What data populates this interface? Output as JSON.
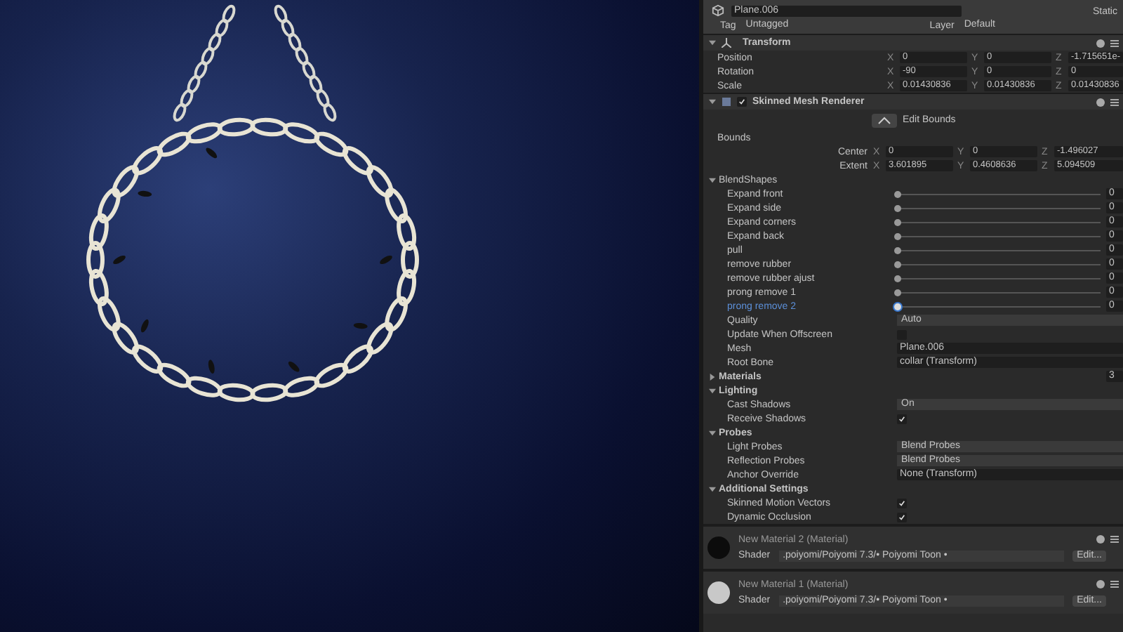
{
  "object": {
    "name": "Plane.006",
    "static_label": "Static",
    "tag_label": "Tag",
    "tag": "Untagged",
    "layer_label": "Layer",
    "layer": "Default"
  },
  "transform": {
    "title": "Transform",
    "expanded": true,
    "fields": [
      {
        "label": "Position",
        "values": [
          {
            "axis": "X",
            "value": "0"
          },
          {
            "axis": "Y",
            "value": "0"
          },
          {
            "axis": "Z",
            "value": "-1.715651e-"
          }
        ]
      },
      {
        "label": "Rotation",
        "values": [
          {
            "axis": "X",
            "value": "-90"
          },
          {
            "axis": "Y",
            "value": "0"
          },
          {
            "axis": "Z",
            "value": "0"
          }
        ]
      },
      {
        "label": "Scale",
        "values": [
          {
            "axis": "X",
            "value": "0.01430836"
          },
          {
            "axis": "Y",
            "value": "0.01430836"
          },
          {
            "axis": "Z",
            "value": "0.01430836"
          }
        ]
      }
    ]
  },
  "renderer": {
    "title": "Skinned Mesh Renderer",
    "expanded": true,
    "enabled": true,
    "edit_bounds": "Edit Bounds",
    "bounds_label": "Bounds",
    "bounds": [
      {
        "label": "Center",
        "values": [
          {
            "axis": "X",
            "value": "0"
          },
          {
            "axis": "Y",
            "value": "0"
          },
          {
            "axis": "Z",
            "value": "-1.496027"
          }
        ]
      },
      {
        "label": "Extent",
        "values": [
          {
            "axis": "X",
            "value": "3.601895"
          },
          {
            "axis": "Y",
            "value": "0.4608636"
          },
          {
            "axis": "Z",
            "value": "5.094509"
          }
        ]
      }
    ],
    "blend_shapes": {
      "title": "BlendShapes",
      "expanded": true,
      "items": [
        {
          "name": "Expand front",
          "level": 0,
          "value": "0",
          "selected": false
        },
        {
          "name": "Expand side",
          "level": 0,
          "value": "0",
          "selected": false
        },
        {
          "name": "Expand corners",
          "level": 0,
          "value": "0",
          "selected": false
        },
        {
          "name": "Expand back",
          "level": 0,
          "value": "0",
          "selected": false
        },
        {
          "name": "pull",
          "level": 0,
          "value": "0",
          "selected": false
        },
        {
          "name": "remove rubber",
          "level": 0,
          "value": "0",
          "selected": false
        },
        {
          "name": "remove rubber ajust",
          "level": 0,
          "value": "0",
          "selected": false
        },
        {
          "name": "prong remove 1",
          "level": 0,
          "value": "0",
          "selected": false
        },
        {
          "name": "prong remove 2",
          "level": 0,
          "value": "0",
          "selected": true
        }
      ]
    },
    "properties": [
      {
        "kind": "dropdown",
        "label": "Quality",
        "value": "Auto"
      },
      {
        "kind": "checkbox",
        "label": "Update When Offscreen",
        "checked": false
      },
      {
        "kind": "object",
        "label": "Mesh",
        "value": "Plane.006"
      },
      {
        "kind": "object",
        "label": "Root Bone",
        "value": "collar (Transform)"
      }
    ],
    "groups": [
      {
        "title": "Materials",
        "expanded": false,
        "count": "3"
      },
      {
        "title": "Lighting",
        "expanded": true,
        "items": [
          {
            "kind": "dropdown",
            "label": "Cast Shadows",
            "value": "On"
          },
          {
            "kind": "checkbox",
            "label": "Receive Shadows",
            "checked": true
          }
        ]
      },
      {
        "title": "Probes",
        "expanded": true,
        "items": [
          {
            "kind": "dropdown",
            "label": "Light Probes",
            "value": "Blend Probes"
          },
          {
            "kind": "dropdown",
            "label": "Reflection Probes",
            "value": "Blend Probes"
          },
          {
            "kind": "object",
            "label": "Anchor Override",
            "value": "None (Transform)"
          }
        ]
      },
      {
        "title": "Additional Settings",
        "expanded": true,
        "items": [
          {
            "kind": "checkbox",
            "label": "Skinned Motion Vectors",
            "checked": true
          },
          {
            "kind": "checkbox",
            "label": "Dynamic Occlusion",
            "checked": true
          }
        ]
      }
    ]
  },
  "materials": [
    {
      "name": "New Material 2 (Material)",
      "color": "#0c0c0c",
      "shader_label": "Shader",
      "shader": ".poiyomi/Poiyomi 7.3/• Poiyomi Toon •",
      "edit": "Edit..."
    },
    {
      "name": "New Material 1 (Material)",
      "color": "#c8c8c8",
      "shader_label": "Shader",
      "shader": ".poiyomi/Poiyomi 7.3/• Poiyomi Toon •",
      "edit": "Edit..."
    }
  ]
}
